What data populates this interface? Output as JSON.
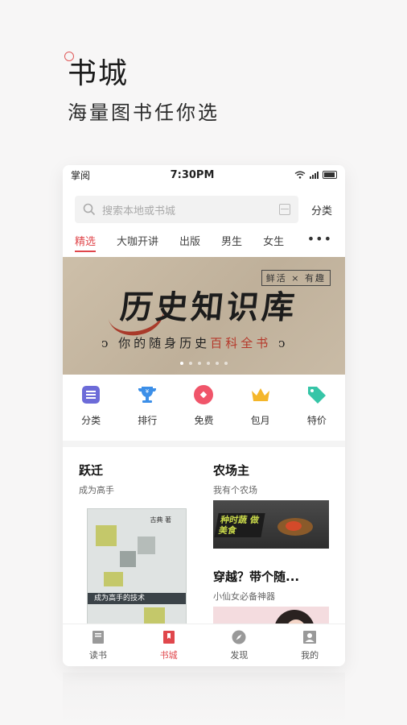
{
  "page": {
    "title": "书城",
    "subtitle": "海量图书任你选"
  },
  "status_bar": {
    "carrier": "掌阅",
    "time": "7:30PM"
  },
  "search": {
    "placeholder": "搜索本地或书城",
    "category_link": "分类"
  },
  "tabs": [
    {
      "label": "精选",
      "active": true
    },
    {
      "label": "大咖开讲",
      "active": false
    },
    {
      "label": "出版",
      "active": false
    },
    {
      "label": "男生",
      "active": false
    },
    {
      "label": "女生",
      "active": false
    }
  ],
  "banner": {
    "tag": "鲜活 × 有趣",
    "title": "历史知识库",
    "caption_parts": [
      "你的随身历史",
      "百科全书"
    ],
    "slide_count": 6,
    "active_slide": 1
  },
  "quick_icons": [
    {
      "label": "分类",
      "icon": "list-icon",
      "color": "#6c6bd8"
    },
    {
      "label": "排行",
      "icon": "trophy-icon",
      "color": "#3c8fe8"
    },
    {
      "label": "免费",
      "icon": "gift-icon",
      "color": "#f0556a"
    },
    {
      "label": "包月",
      "icon": "crown-icon",
      "color": "#f4b62a"
    },
    {
      "label": "特价",
      "icon": "price-tag-icon",
      "color": "#36c5a7"
    }
  ],
  "cards": [
    {
      "title": "跃迁",
      "subtitle": "成为高手",
      "cover_author": "古典 著",
      "cover_title": "成为高手的技术"
    },
    {
      "title": "农场主",
      "subtitle": "我有个农场",
      "cover_text": "种时蔬 做美食"
    },
    {
      "title": "穿越？带个随...",
      "subtitle": "小仙女必备神器"
    }
  ],
  "bottom_nav": [
    {
      "label": "读书",
      "icon": "book-icon",
      "active": false
    },
    {
      "label": "书城",
      "icon": "bookmark-icon",
      "active": true
    },
    {
      "label": "发现",
      "icon": "compass-icon",
      "active": false
    },
    {
      "label": "我的",
      "icon": "user-icon",
      "active": false
    }
  ],
  "colors": {
    "accent": "#e0474c"
  }
}
